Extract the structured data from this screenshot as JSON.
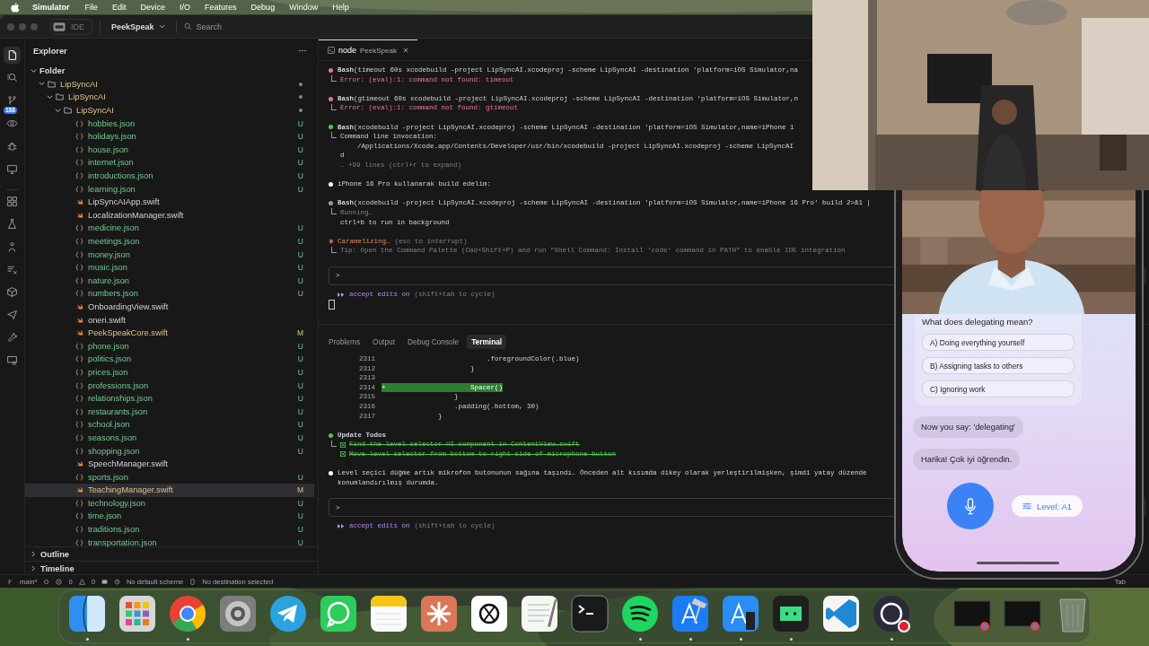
{
  "menu_bar": {
    "app": "Simulator",
    "items": [
      "File",
      "Edit",
      "Device",
      "I/O",
      "Features",
      "Debug",
      "Window",
      "Help"
    ]
  },
  "title_bar": {
    "layout_label": "IDE",
    "project": "PeekSpeak",
    "search_placeholder": "Search"
  },
  "activity_bar": [
    {
      "kind": "explorer",
      "selected": true
    },
    {
      "kind": "search",
      "selected": false
    },
    {
      "kind": "source-control",
      "selected": false,
      "badge": "188"
    },
    {
      "kind": "preview",
      "selected": false
    },
    {
      "kind": "debug",
      "selected": false
    },
    {
      "kind": "remote",
      "selected": false
    },
    {
      "kind": "extensions",
      "selected": false
    },
    {
      "kind": "testing",
      "selected": false
    },
    {
      "kind": "person",
      "selected": false
    },
    {
      "kind": "filter",
      "selected": false
    },
    {
      "kind": "package",
      "selected": false
    },
    {
      "kind": "plane",
      "selected": false
    },
    {
      "kind": "tools",
      "selected": false
    },
    {
      "kind": "screen",
      "selected": false
    }
  ],
  "explorer": {
    "title": "Explorer",
    "tree": [
      {
        "label": "Folder",
        "kind": "section",
        "expanded": true,
        "children": [
          {
            "label": "LipSyncAI",
            "kind": "folder",
            "expanded": true,
            "changed": true,
            "children": [
              {
                "label": "LipSyncAI",
                "kind": "folder",
                "expanded": true,
                "changed": true,
                "children": [
                  {
                    "label": "LipSyncAI",
                    "kind": "folder",
                    "expanded": true,
                    "changed": true,
                    "children": [
                      {
                        "label": "hobbies.json",
                        "kind": "json",
                        "status": "U",
                        "selected": false
                      },
                      {
                        "label": "holidays.json",
                        "kind": "json",
                        "status": "U",
                        "selected": false
                      },
                      {
                        "label": "house.json",
                        "kind": "json",
                        "status": "U",
                        "selected": false
                      },
                      {
                        "label": "internet.json",
                        "kind": "json",
                        "status": "U",
                        "selected": false
                      },
                      {
                        "label": "introductions.json",
                        "kind": "json",
                        "status": "U",
                        "selected": false
                      },
                      {
                        "label": "learning.json",
                        "kind": "json",
                        "status": "U",
                        "selected": false
                      },
                      {
                        "label": "LipSyncAIApp.swift",
                        "kind": "swift",
                        "selected": false
                      },
                      {
                        "label": "LocalizationManager.swift",
                        "kind": "swift",
                        "selected": false
                      },
                      {
                        "label": "medicine.json",
                        "kind": "json",
                        "status": "U",
                        "selected": false
                      },
                      {
                        "label": "meetings.json",
                        "kind": "json",
                        "status": "U",
                        "selected": false
                      },
                      {
                        "label": "money.json",
                        "kind": "json",
                        "status": "U",
                        "selected": false
                      },
                      {
                        "label": "music.json",
                        "kind": "json",
                        "status": "U",
                        "selected": false
                      },
                      {
                        "label": "nature.json",
                        "kind": "json",
                        "status": "U",
                        "selected": false
                      },
                      {
                        "label": "numbers.json",
                        "kind": "json",
                        "status": "U",
                        "selected": false
                      },
                      {
                        "label": "OnboardingView.swift",
                        "kind": "swift",
                        "selected": false
                      },
                      {
                        "label": "oneri.swift",
                        "kind": "swift",
                        "selected": false
                      },
                      {
                        "label": "PeekSpeakCore.swift",
                        "kind": "swift",
                        "status": "M",
                        "selected": false
                      },
                      {
                        "label": "phone.json",
                        "kind": "json",
                        "status": "U",
                        "selected": false
                      },
                      {
                        "label": "politics.json",
                        "kind": "json",
                        "status": "U",
                        "selected": false
                      },
                      {
                        "label": "prices.json",
                        "kind": "json",
                        "status": "U",
                        "selected": false
                      },
                      {
                        "label": "professions.json",
                        "kind": "json",
                        "status": "U",
                        "selected": false
                      },
                      {
                        "label": "relationships.json",
                        "kind": "json",
                        "status": "U",
                        "selected": false
                      },
                      {
                        "label": "restaurants.json",
                        "kind": "json",
                        "status": "U",
                        "selected": false
                      },
                      {
                        "label": "school.json",
                        "kind": "json",
                        "status": "U",
                        "selected": false
                      },
                      {
                        "label": "seasons.json",
                        "kind": "json",
                        "status": "U",
                        "selected": false
                      },
                      {
                        "label": "shopping.json",
                        "kind": "json",
                        "status": "U",
                        "selected": false
                      },
                      {
                        "label": "SpeechManager.swift",
                        "kind": "swift",
                        "selected": false
                      },
                      {
                        "label": "sports.json",
                        "kind": "json",
                        "status": "U",
                        "selected": false
                      },
                      {
                        "label": "TeachingManager.swift",
                        "kind": "swift",
                        "status": "M",
                        "selected": true
                      },
                      {
                        "label": "technology.json",
                        "kind": "json",
                        "status": "U",
                        "selected": false
                      },
                      {
                        "label": "time.json",
                        "kind": "json",
                        "status": "U",
                        "selected": false
                      },
                      {
                        "label": "traditions.json",
                        "kind": "json",
                        "status": "U",
                        "selected": false
                      },
                      {
                        "label": "transportation.json",
                        "kind": "json",
                        "status": "U",
                        "selected": false
                      }
                    ]
                  }
                ]
              }
            ]
          }
        ]
      }
    ],
    "sections": [
      {
        "label": "Outline",
        "expanded": false
      },
      {
        "label": "Timeline",
        "expanded": false
      }
    ]
  },
  "editor_tab": {
    "label": "node",
    "detail": "PeekSpeak"
  },
  "agent_log": [
    {
      "kind": "error",
      "text": "**Bash**(timeout 60s xcodebuild -project LipSyncAI.xcodeproj -scheme LipSyncAI -destination 'platform=iOS Simulator,na",
      "output": [
        {
          "kind": "error",
          "text": "Error: (eval):1: command not found: timeout"
        }
      ]
    },
    {
      "kind": "error",
      "text": "**Bash**(gtimeout 60s xcodebuild -project LipSyncAI.xcodeproj -scheme LipSyncAI -destination 'platform=iOS Simulator,n",
      "output": [
        {
          "kind": "error",
          "text": "Error: (eval):1: command not found: gtimeout"
        }
      ]
    },
    {
      "kind": "success",
      "text": "**Bash**(xcodebuild -project LipSyncAI.xcodeproj -scheme LipSyncAI -destination 'platform=iOS Simulator,name=iPhone 1",
      "output": [
        {
          "kind": "plain",
          "text": "Command line invocation:"
        },
        {
          "kind": "indented",
          "text": "/Applications/Xcode.app/Contents/Developer/usr/bin/xcodebuild -project LipSyncAI.xcodeproj -scheme LipSyncAI"
        },
        {
          "kind": "plain",
          "text": "d"
        },
        {
          "kind": "dim",
          "text": "… +99 lines (ctrl+r to expand)"
        }
      ]
    },
    {
      "kind": "message",
      "text": "iPhone 16 Pro kullanarak build edelim:"
    },
    {
      "kind": "running",
      "text": "**Bash**(xcodebuild -project LipSyncAI.xcodeproj -scheme LipSyncAI -destination 'platform=iOS Simulator,name=iPhone 16 Pro' build 2>&1 |",
      "output": [
        {
          "kind": "dim",
          "text": "Running…"
        },
        {
          "kind": "plain",
          "text": "ctrl+b to run in background"
        }
      ]
    },
    {
      "kind": "thinking",
      "text": "Caramelizing…",
      "hint": "(esc to interrupt)",
      "output": [
        {
          "kind": "dim",
          "text": "Tip: Open the Command Palette (Cmd+Shift+P) and run \"Shell Command: Install 'code' command in PATH\" to enable IDE integration"
        }
      ]
    }
  ],
  "agent_prompt": {
    "symbol": ">",
    "mode": "accept edits on",
    "hint": "(shift+tab to cycle)"
  },
  "panel": {
    "tabs": [
      {
        "label": "Problems",
        "selected": false
      },
      {
        "label": "Output",
        "selected": false
      },
      {
        "label": "Debug Console",
        "selected": false
      },
      {
        "label": "Terminal",
        "selected": true
      }
    ],
    "diff": [
      {
        "number": "2311",
        "text": "                          .foregroundColor(.blue)",
        "added": false
      },
      {
        "number": "2312",
        "text": "                      }",
        "added": false
      },
      {
        "number": "2313",
        "added": false
      },
      {
        "number": "2314",
        "sign": "+",
        "text": "                     Spacer()",
        "added": true
      },
      {
        "number": "2315",
        "text": "                  }",
        "added": false
      },
      {
        "number": "2316",
        "text": "                  .padding(.bottom, 30)",
        "added": false
      },
      {
        "number": "2317",
        "text": "              }",
        "added": false
      }
    ],
    "todos": {
      "title": "Update Todos",
      "items": [
        {
          "text": "Find the level selector UI component in ContentView.swift",
          "done": true
        },
        {
          "text": "Move level selector from bottom to right side of microphone button",
          "done": true
        }
      ]
    },
    "message": "Level seçici düğme artık mikrofon butonunun sağına taşındı. Önceden alt kısımda dikey olarak yerleştirilmişken, şimdi yatay düzende konumlandırılmış durumda.",
    "prompt": {
      "symbol": ">",
      "mode": "accept edits on",
      "hint": "(shift+tab to cycle)"
    }
  },
  "status_bar": {
    "branch": "main*",
    "errors": "0",
    "warnings": "0",
    "scheme": "No default scheme",
    "destination": "No destination selected",
    "right": "Tab"
  },
  "phone": {
    "question": "What does delegating mean?",
    "options": [
      "A) Doing everything yourself",
      "B) Assigning tasks to others",
      "C) Ignoring work"
    ],
    "messages": [
      "Now you say: 'delegating'",
      "Harika! Çok iyi öğrendin."
    ],
    "level_button": "Level: A1"
  },
  "dock": {
    "apps": [
      {
        "kind": "finder",
        "running": true
      },
      {
        "kind": "launchpad",
        "running": false
      },
      {
        "kind": "chrome",
        "running": true
      },
      {
        "kind": "settings",
        "running": false
      },
      {
        "kind": "telegram",
        "running": false
      },
      {
        "kind": "whatsapp",
        "running": false
      },
      {
        "kind": "notes",
        "running": false
      },
      {
        "kind": "claude",
        "running": false
      },
      {
        "kind": "chatgpt",
        "running": false
      },
      {
        "kind": "textedit",
        "running": false
      },
      {
        "kind": "terminal",
        "running": false
      },
      {
        "kind": "spotify",
        "running": true
      },
      {
        "kind": "xcode",
        "running": true
      },
      {
        "kind": "simulator",
        "running": true
      },
      {
        "kind": "tape",
        "running": true
      },
      {
        "kind": "vscode",
        "running": false
      },
      {
        "kind": "obs",
        "running": true
      }
    ],
    "stack": [
      {
        "kind": "thumbnail"
      },
      {
        "kind": "thumbnail"
      },
      {
        "kind": "trash"
      }
    ]
  }
}
